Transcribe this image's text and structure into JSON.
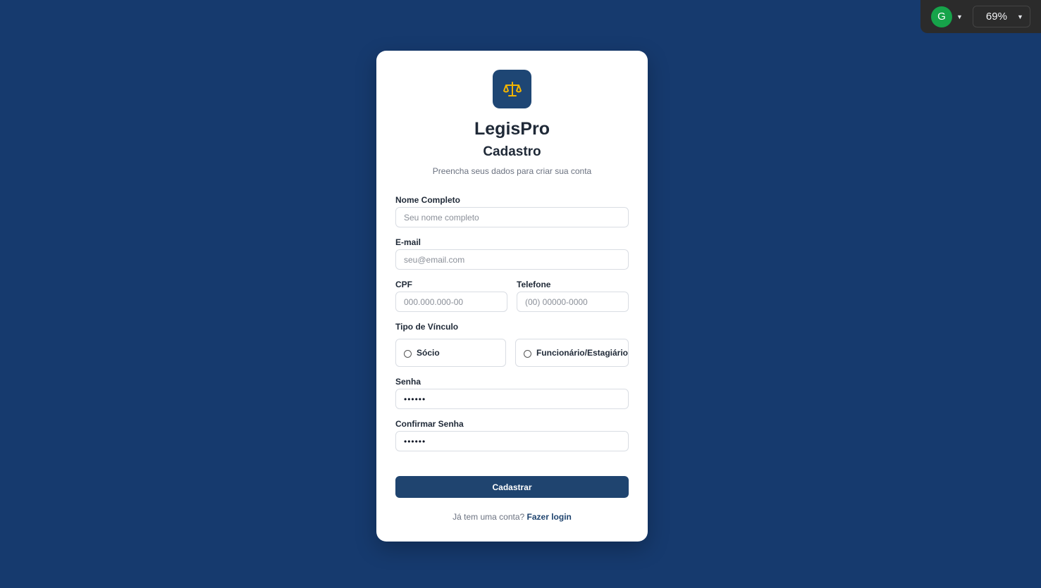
{
  "toolbar": {
    "avatar_letter": "G",
    "zoom": "69%",
    "avatar_color": "#16a34a"
  },
  "brand": {
    "name": "LegisPro",
    "logo_icon": "scales-of-justice-icon",
    "logo_bg": "#1e4674",
    "logo_fg": "#f2b400"
  },
  "form": {
    "heading": "Cadastro",
    "subtitle": "Preencha seus dados para criar sua conta",
    "name_label": "Nome Completo",
    "name_placeholder": "Seu nome completo",
    "email_label": "E-mail",
    "email_placeholder": "seu@email.com",
    "cpf_label": "CPF",
    "cpf_placeholder": "000.000.000-00",
    "phone_label": "Telefone",
    "phone_placeholder": "(00) 00000-0000",
    "bond_label": "Tipo de Vínculo",
    "bond_options": [
      "Sócio",
      "Funcionário/Estagiário"
    ],
    "password_label": "Senha",
    "password_value": "••••••",
    "confirm_label": "Confirmar Senha",
    "confirm_value": "••••••",
    "submit_label": "Cadastrar",
    "footer_text": "Já tem uma conta?",
    "footer_link": "Fazer login"
  },
  "colors": {
    "background": "#163a6e",
    "primary": "#1f446f"
  }
}
